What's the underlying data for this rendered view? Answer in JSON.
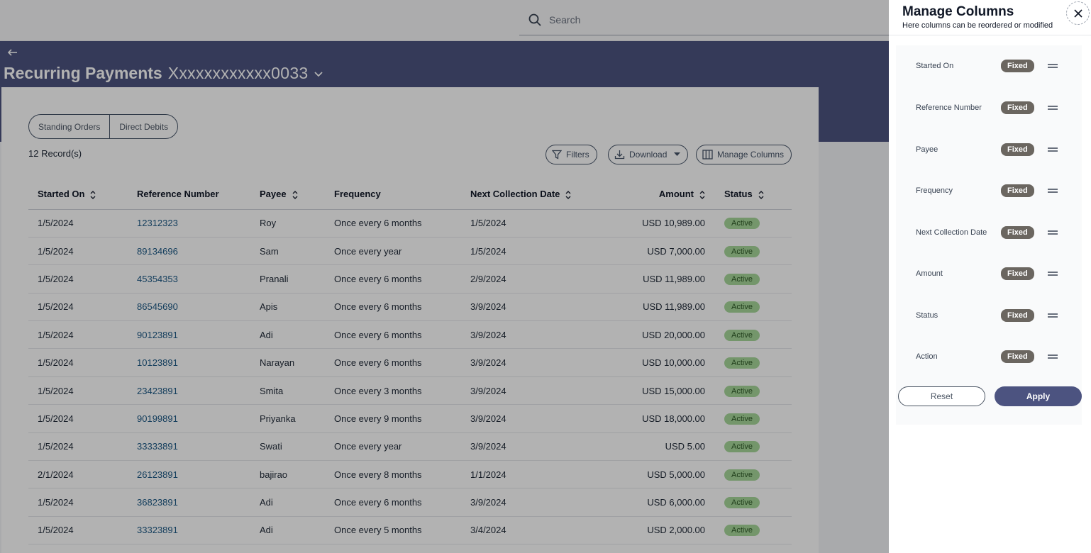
{
  "search": {
    "placeholder": "Search"
  },
  "header": {
    "back_icon": "arrow-left-icon",
    "title": "Recurring Payments",
    "account": "Xxxxxxxxxxxx0033"
  },
  "tabs": [
    {
      "label": "Standing Orders"
    },
    {
      "label": "Direct Debits"
    }
  ],
  "records_label": "12 Record(s)",
  "toolbar": {
    "filters": "Filters",
    "download": "Download",
    "manage_columns": "Manage Columns"
  },
  "table": {
    "columns": [
      "Started On",
      "Reference Number",
      "Payee",
      "Frequency",
      "Next Collection Date",
      "Amount",
      "Status"
    ],
    "rows": [
      [
        "1/5/2024",
        "12312323",
        "Roy",
        "Once every 6 months",
        "1/5/2024",
        "USD 10,989.00",
        "Active"
      ],
      [
        "1/5/2024",
        "89134696",
        "Sam",
        "Once every year",
        "1/5/2024",
        "USD 7,000.00",
        "Active"
      ],
      [
        "1/5/2024",
        "45354353",
        "Pranali",
        "Once every 6 months",
        "2/9/2024",
        "USD 11,989.00",
        "Active"
      ],
      [
        "1/5/2024",
        "86545690",
        "Apis",
        "Once every 6 months",
        "3/9/2024",
        "USD 11,989.00",
        "Active"
      ],
      [
        "1/5/2024",
        "90123891",
        "Adi",
        "Once every 6 months",
        "3/9/2024",
        "USD 20,000.00",
        "Active"
      ],
      [
        "1/5/2024",
        "10123891",
        "Narayan",
        "Once every 6 months",
        "3/9/2024",
        "USD 10,000.00",
        "Active"
      ],
      [
        "1/5/2024",
        "23423891",
        "Smita",
        "Once every 3 months",
        "3/9/2024",
        "USD 15,000.00",
        "Active"
      ],
      [
        "1/5/2024",
        "90199891",
        "Priyanka",
        "Once every 9 months",
        "3/9/2024",
        "USD 18,000.00",
        "Active"
      ],
      [
        "1/5/2024",
        "33333891",
        "Swati",
        "Once every year",
        "3/9/2024",
        "USD 5.00",
        "Active"
      ],
      [
        "2/1/2024",
        "26123891",
        "bajirao",
        "Once every 8 months",
        "1/1/2024",
        "USD 5,000.00",
        "Active"
      ],
      [
        "1/5/2024",
        "36823891",
        "Adi",
        "Once every 6 months",
        "3/9/2024",
        "USD 6,000.00",
        "Active"
      ],
      [
        "1/5/2024",
        "33323891",
        "Adi",
        "Once every 5 months",
        "3/4/2024",
        "USD 2,000.00",
        "Active"
      ]
    ]
  },
  "panel": {
    "title": "Manage Columns",
    "subtitle": "Here columns can be reordered or modified",
    "items": [
      {
        "label": "Started On",
        "badge": "Fixed"
      },
      {
        "label": "Reference Number",
        "badge": "Fixed"
      },
      {
        "label": "Payee",
        "badge": "Fixed"
      },
      {
        "label": "Frequency",
        "badge": "Fixed"
      },
      {
        "label": "Next Collection Date",
        "badge": "Fixed"
      },
      {
        "label": "Amount",
        "badge": "Fixed"
      },
      {
        "label": "Status",
        "badge": "Fixed"
      },
      {
        "label": "Action",
        "badge": "Fixed"
      }
    ],
    "reset": "Reset",
    "apply": "Apply"
  },
  "colors": {
    "brand": "#4c5380",
    "link": "#1e5a86",
    "active_badge": "#a7d79a"
  }
}
